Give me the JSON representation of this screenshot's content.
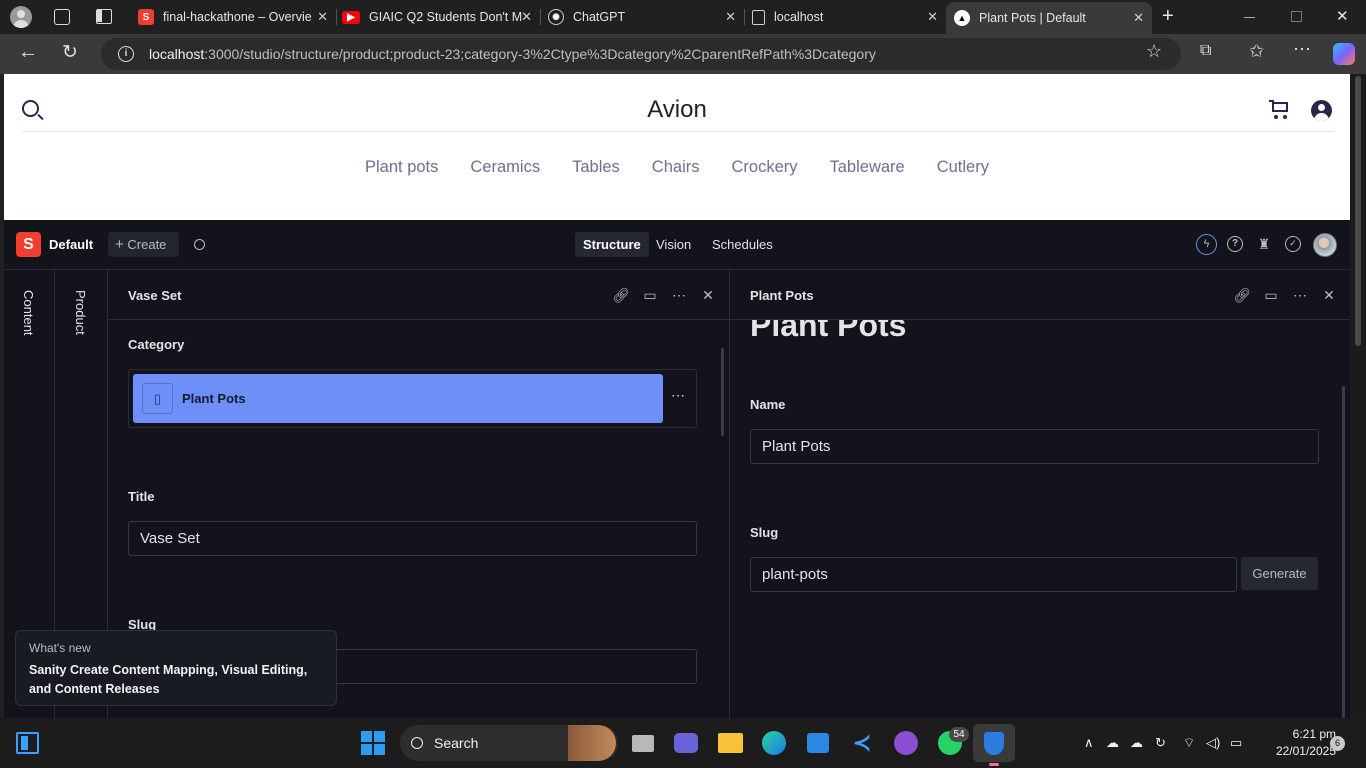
{
  "browser": {
    "tabs": [
      {
        "title": "final-hackathone – Overvie",
        "icon": "sanity-icon",
        "color": "#f03e2f"
      },
      {
        "title": "GIAIC Q2 Students Don't M",
        "icon": "youtube-icon",
        "color": "#ff0000"
      },
      {
        "title": "ChatGPT",
        "icon": "chatgpt-icon",
        "color": "#cfcfcf"
      },
      {
        "title": "localhost",
        "icon": "page-icon",
        "color": "#cfcfcf"
      },
      {
        "title": "Plant Pots | Default",
        "icon": "triangle-icon",
        "color": "#ffffff"
      }
    ],
    "url_host": "localhost",
    "url_rest": ":3000/studio/structure/product;product-23;category-3%2Ctype%3Dcategory%2CparentRefPath%3Dcategory"
  },
  "site": {
    "logo": "Avion",
    "nav": [
      "Plant pots",
      "Ceramics",
      "Tables",
      "Chairs",
      "Crockery",
      "Tableware",
      "Cutlery"
    ]
  },
  "studio": {
    "workspace": "Default",
    "create_label": "Create",
    "nav": [
      "Structure",
      "Vision",
      "Schedules"
    ],
    "active_nav": "Structure",
    "rails": [
      "Content",
      "Product"
    ],
    "left_pane": {
      "title": "Vase Set",
      "category_label": "Category",
      "category_ref": "Plant Pots",
      "title_label": "Title",
      "title_value": "Vase Set",
      "slug_label": "Slug"
    },
    "right_pane": {
      "title": "Plant Pots",
      "heading": "Plant Pots",
      "name_label": "Name",
      "name_value": "Plant Pots",
      "slug_label": "Slug",
      "slug_value": "plant-pots",
      "generate_label": "Generate"
    },
    "whats_new": {
      "kicker": "What's new",
      "body": "Sanity Create Content Mapping, Visual Editing, and Content Releases"
    },
    "accent": "#6e8ff8"
  },
  "taskbar": {
    "search_label": "Search",
    "whatsapp_badge": "54",
    "time": "6:21 pm",
    "date": "22/01/2025",
    "notification_count": "6"
  }
}
